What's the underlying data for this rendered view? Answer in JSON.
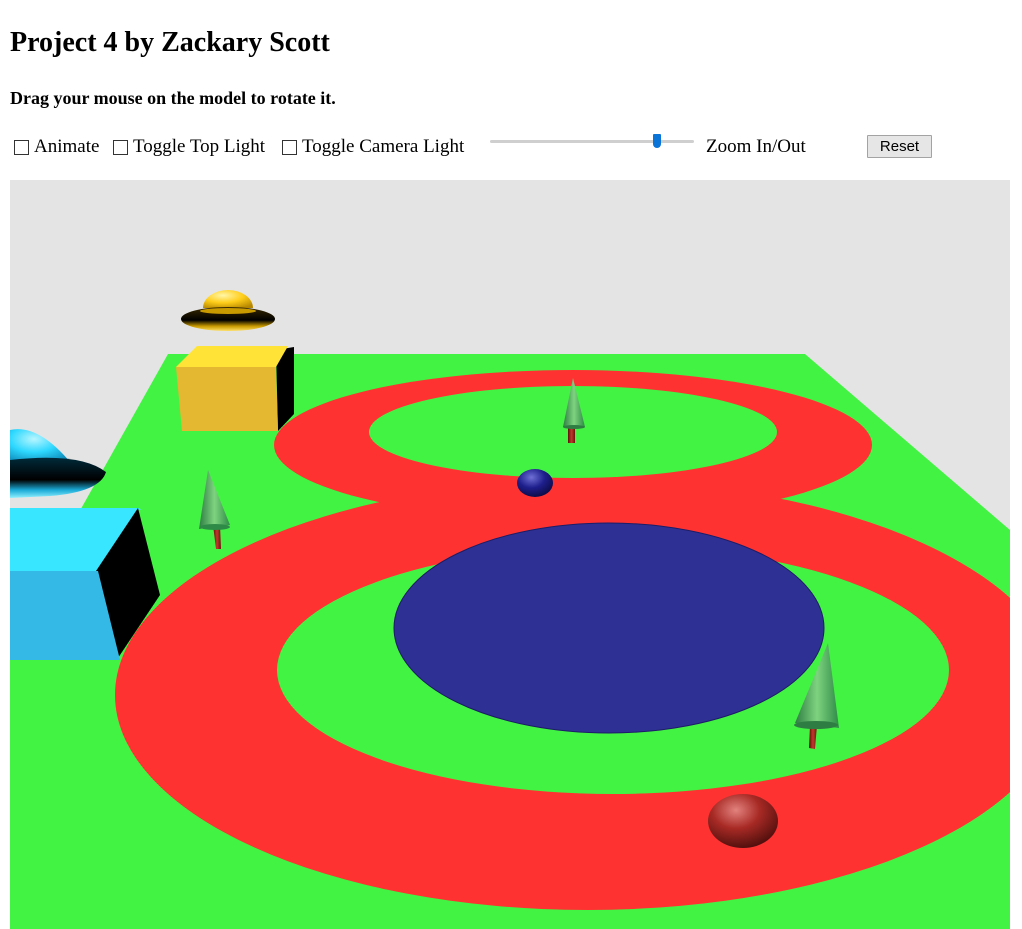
{
  "page": {
    "title": "Project 4 by Zackary Scott",
    "instructions": "Drag your mouse on the model to rotate it."
  },
  "controls": {
    "animate_label": "Animate",
    "animate_checked": false,
    "top_light_label": "Toggle Top Light",
    "top_light_checked": false,
    "camera_light_label": "Toggle Camera Light",
    "camera_light_checked": false,
    "zoom_label": "Zoom In/Out",
    "zoom_level": 0.85,
    "reset_label": "Reset"
  },
  "scene": {
    "colors": {
      "background": "#e4e4e4",
      "ground": "#43f343",
      "track": "#ff3232",
      "pond": "#2f3094",
      "yellow_cube": "#fcd535",
      "blue_cube": "#34b9e6",
      "tree_foliage": "#3ea85a",
      "tree_trunk": "#a1251d",
      "red_ball": "#a82a25",
      "blue_ball": "#1e1e8c",
      "ufo_yellow": "#ffce1a",
      "ufo_cyan": "#2ed8ff"
    },
    "objects": [
      "ground-plane",
      "figure-eight-track",
      "pond",
      "yellow-cube",
      "cyan-cube",
      "yellow-ufo",
      "cyan-ufo",
      "tree",
      "tree",
      "tree",
      "red-ball",
      "blue-ball"
    ]
  }
}
